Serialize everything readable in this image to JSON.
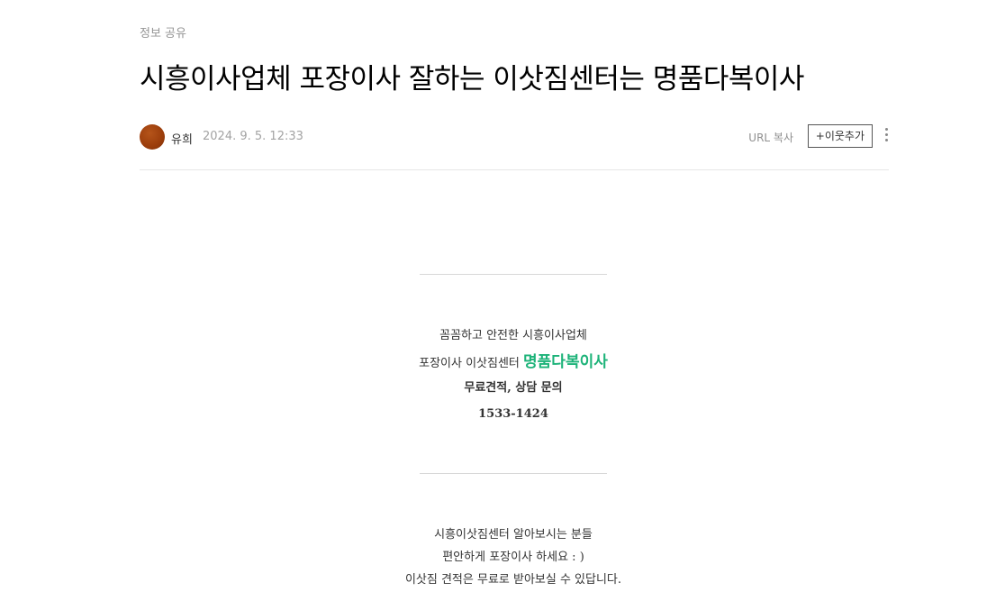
{
  "post": {
    "category": "정보 공유",
    "title": "시흥이사업체 포장이사 잘하는 이삿짐센터는 명품다복이사",
    "author": "유희",
    "date": "2024. 9. 5. 12:33",
    "url_copy": "URL 복사",
    "add_neighbor": "+이웃추가",
    "more_icon": "more-vertical-icon"
  },
  "content": {
    "block1": {
      "line1": "꼼꼼하고 안전한 시흥이사업체",
      "line2_prefix": "포장이사 이삿짐센터 ",
      "line2_highlight": "명품다복이사",
      "line3": "무료견적, 상담 문의",
      "line4": "1533-1424"
    },
    "block2": {
      "line1": "시흥이삿짐센터 알아보시는 분들",
      "line2": "편안하게 포장이사 하세요 : )",
      "line3": "이삿짐 견적은 무료로 받아보실 수 있답니다."
    }
  },
  "colors": {
    "highlight": "#1db379",
    "avatar": "#9b3d0b"
  }
}
